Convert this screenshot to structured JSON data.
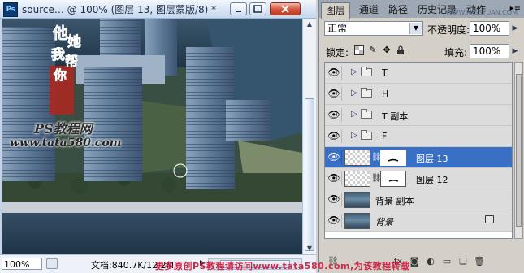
{
  "document": {
    "title": "source… @ 100% (图层 13, 图层蒙版/8) *",
    "app_icon_label": "Ps",
    "zoom": "100%",
    "doc_size": "文档:840.7K/12.2M",
    "canvas_watermark_ps": "PS教程网",
    "canvas_watermark_site": "www.tata580.com"
  },
  "panel": {
    "tabs": [
      {
        "label": "图层",
        "active": true
      },
      {
        "label": "通道",
        "active": false
      },
      {
        "label": "路径",
        "active": false
      },
      {
        "label": "历史记录",
        "active": false
      },
      {
        "label": "动作",
        "active": false
      }
    ],
    "blend_mode": "正常",
    "opacity_label": "不透明度:",
    "opacity_value": "100%",
    "lock_label": "锁定:",
    "fill_label": "填充:",
    "fill_value": "100%",
    "top_watermark": "WWW.MISSYUAN.COM",
    "bottom_watermark": "更多原创PS教程请访问www.tata580.com,为该教程转载",
    "layers": [
      {
        "name": "T",
        "type": "group",
        "selected": false
      },
      {
        "name": "H",
        "type": "group",
        "selected": false
      },
      {
        "name": "T 副本",
        "type": "group",
        "selected": false
      },
      {
        "name": "F",
        "type": "group",
        "selected": false
      },
      {
        "name": "图层 13",
        "type": "masked",
        "selected": true
      },
      {
        "name": "图层 12",
        "type": "masked",
        "selected": false
      },
      {
        "name": "背景 副本",
        "type": "image",
        "selected": false
      },
      {
        "name": "背景",
        "type": "background",
        "selected": false
      }
    ]
  },
  "colors": {
    "selection": "#3a6fc6",
    "panel_bg": "#d4d0c8",
    "watermark_red": "#d0284a"
  }
}
